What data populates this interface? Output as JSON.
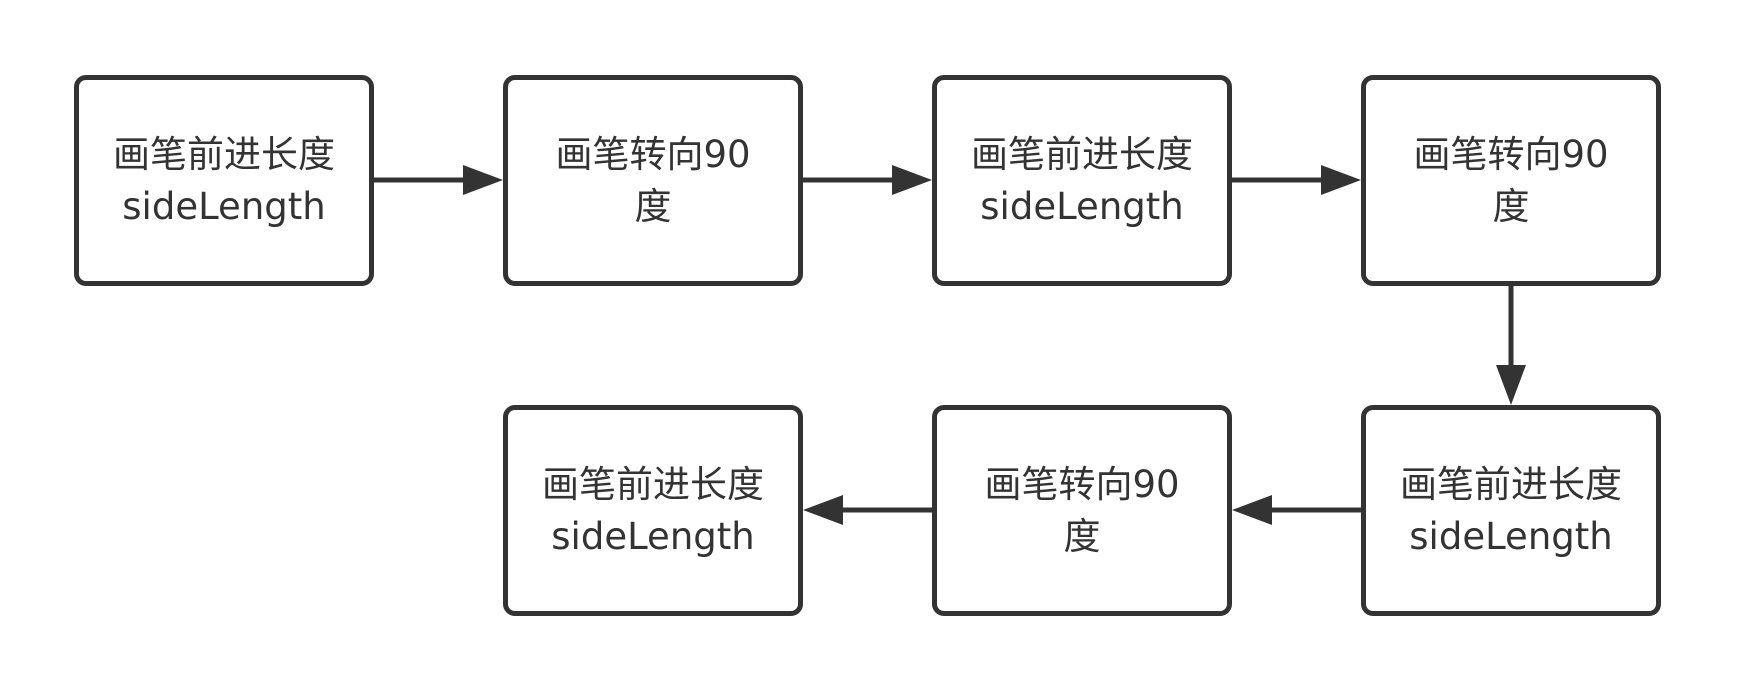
{
  "diagram": {
    "nodes": [
      {
        "id": "n1",
        "label": "画笔前进长度\nsideLength"
      },
      {
        "id": "n2",
        "label": "画笔转向90\n度"
      },
      {
        "id": "n3",
        "label": "画笔前进长度\nsideLength"
      },
      {
        "id": "n4",
        "label": "画笔转向90\n度"
      },
      {
        "id": "n5",
        "label": "画笔前进长度\nsideLength"
      },
      {
        "id": "n6",
        "label": "画笔转向90\n度"
      },
      {
        "id": "n7",
        "label": "画笔前进长度\nsideLength"
      }
    ],
    "edges": [
      {
        "from": "n1",
        "to": "n2"
      },
      {
        "from": "n2",
        "to": "n3"
      },
      {
        "from": "n3",
        "to": "n4"
      },
      {
        "from": "n4",
        "to": "n5"
      },
      {
        "from": "n5",
        "to": "n6"
      },
      {
        "from": "n6",
        "to": "n7"
      }
    ],
    "colors": {
      "stroke": "#333333",
      "background": "#ffffff"
    }
  }
}
